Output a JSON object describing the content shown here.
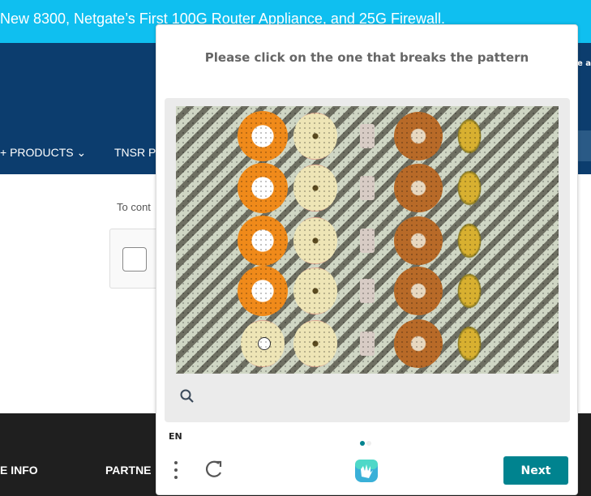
{
  "page": {
    "banner": "New 8300, Netgate’s First 100G Router Appliance, and 25G Firewall.",
    "nav_items": [
      "+ PRODUCTS ⌄",
      "TNSR P"
    ],
    "nav_right_text": "e a",
    "content_text": "To cont",
    "footer_items": [
      "E INFO",
      "PARTNE"
    ]
  },
  "captcha": {
    "prompt": "Please click on the one that breaks the pattern",
    "language": "EN",
    "next_label": "Next",
    "page_indicator": {
      "current": 1,
      "total": 2
    },
    "accent_color": "#00838f",
    "icons": {
      "zoom": "search-icon",
      "menu": "more-vertical-icon",
      "refresh": "refresh-icon",
      "logo": "hcaptcha-logo"
    }
  }
}
